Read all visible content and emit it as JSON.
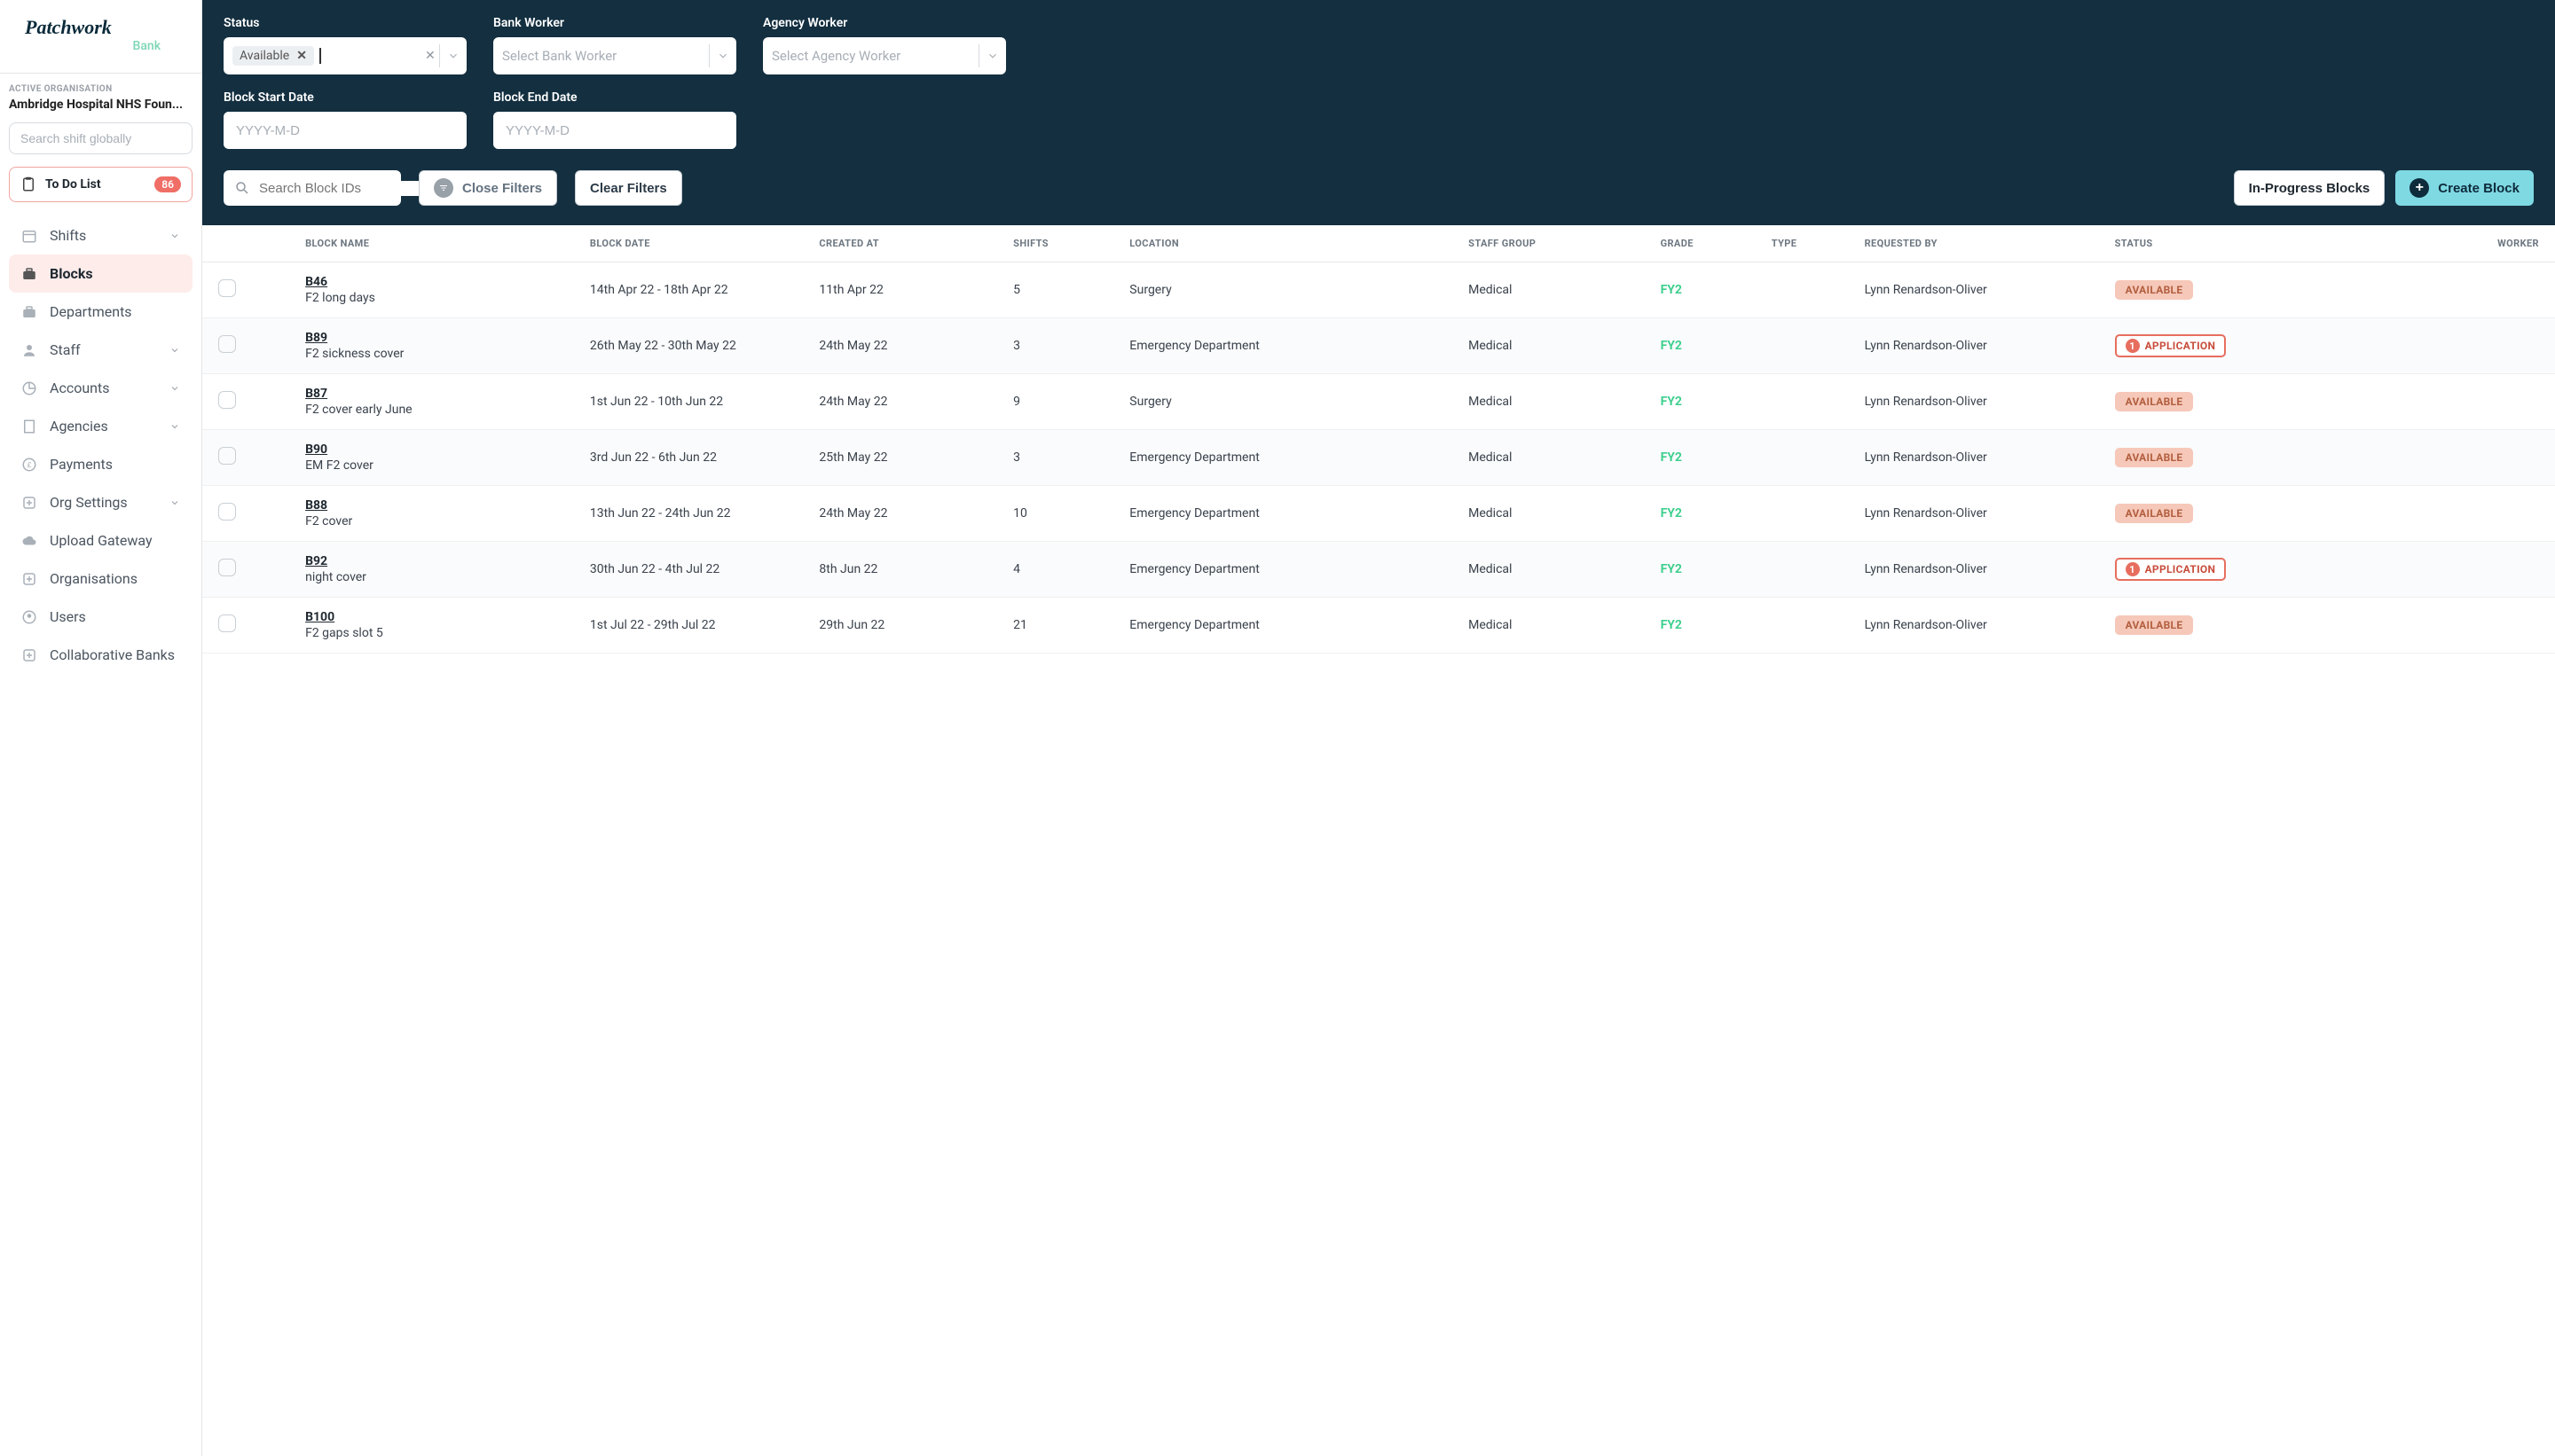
{
  "logo": {
    "main": "Patchwork",
    "sub": "Bank"
  },
  "orgLabel": "ACTIVE ORGANISATION",
  "orgName": "Ambridge Hospital NHS Foun...",
  "globalSearchPlaceholder": "Search shift globally",
  "todo": {
    "label": "To Do List",
    "count": "86"
  },
  "nav": [
    {
      "label": "Shifts",
      "icon": "calendar",
      "expandable": true
    },
    {
      "label": "Blocks",
      "icon": "briefcase",
      "active": true
    },
    {
      "label": "Departments",
      "icon": "briefcase"
    },
    {
      "label": "Staff",
      "icon": "user",
      "expandable": true
    },
    {
      "label": "Accounts",
      "icon": "chart",
      "expandable": true
    },
    {
      "label": "Agencies",
      "icon": "building",
      "expandable": true
    },
    {
      "label": "Payments",
      "icon": "currency"
    },
    {
      "label": "Org Settings",
      "icon": "plus-square",
      "expandable": true
    },
    {
      "label": "Upload Gateway",
      "icon": "cloud"
    },
    {
      "label": "Organisations",
      "icon": "plus-square"
    },
    {
      "label": "Users",
      "icon": "user-circle"
    },
    {
      "label": "Collaborative Banks",
      "icon": "plus-square"
    }
  ],
  "filters": {
    "statusLabel": "Status",
    "statusChip": "Available",
    "bankWorkerLabel": "Bank Worker",
    "bankWorkerPlaceholder": "Select Bank Worker",
    "agencyWorkerLabel": "Agency Worker",
    "agencyWorkerPlaceholder": "Select Agency Worker",
    "startLabel": "Block Start Date",
    "endLabel": "Block End Date",
    "datePlaceholder": "YYYY-M-D"
  },
  "toolbar": {
    "searchPlaceholder": "Search Block IDs",
    "closeFilters": "Close Filters",
    "clearFilters": "Clear Filters",
    "inProgress": "In-Progress Blocks",
    "create": "Create Block"
  },
  "table": {
    "headers": [
      "",
      "BLOCK NAME",
      "BLOCK DATE",
      "CREATED AT",
      "SHIFTS",
      "LOCATION",
      "STAFF GROUP",
      "GRADE",
      "TYPE",
      "REQUESTED BY",
      "STATUS",
      "WORKER"
    ],
    "rows": [
      {
        "id": "B46",
        "desc": "F2 long days",
        "date": "14th Apr 22 - 18th Apr 22",
        "created": "11th Apr 22",
        "shifts": "5",
        "location": "Surgery",
        "staff": "Medical",
        "grade": "FY2",
        "type": "",
        "requested": "Lynn Renardson-Oliver",
        "status": "AVAILABLE",
        "statusType": "available"
      },
      {
        "id": "B89",
        "desc": "F2 sickness cover",
        "date": "26th May 22 - 30th May 22",
        "created": "24th May 22",
        "shifts": "3",
        "location": "Emergency Department",
        "staff": "Medical",
        "grade": "FY2",
        "type": "",
        "requested": "Lynn Renardson-Oliver",
        "status": "APPLICATION",
        "statusType": "application",
        "count": "1"
      },
      {
        "id": "B87",
        "desc": "F2 cover early June",
        "date": "1st Jun 22 - 10th Jun 22",
        "created": "24th May 22",
        "shifts": "9",
        "location": "Surgery",
        "staff": "Medical",
        "grade": "FY2",
        "type": "",
        "requested": "Lynn Renardson-Oliver",
        "status": "AVAILABLE",
        "statusType": "available"
      },
      {
        "id": "B90",
        "desc": "EM F2 cover",
        "date": "3rd Jun 22 - 6th Jun 22",
        "created": "25th May 22",
        "shifts": "3",
        "location": "Emergency Department",
        "staff": "Medical",
        "grade": "FY2",
        "type": "",
        "requested": "Lynn Renardson-Oliver",
        "status": "AVAILABLE",
        "statusType": "available"
      },
      {
        "id": "B88",
        "desc": "F2 cover",
        "date": "13th Jun 22 - 24th Jun 22",
        "created": "24th May 22",
        "shifts": "10",
        "location": "Emergency Department",
        "staff": "Medical",
        "grade": "FY2",
        "type": "",
        "requested": "Lynn Renardson-Oliver",
        "status": "AVAILABLE",
        "statusType": "available"
      },
      {
        "id": "B92",
        "desc": "night cover",
        "date": "30th Jun 22 - 4th Jul 22",
        "created": "8th Jun 22",
        "shifts": "4",
        "location": "Emergency Department",
        "staff": "Medical",
        "grade": "FY2",
        "type": "",
        "requested": "Lynn Renardson-Oliver",
        "status": "APPLICATION",
        "statusType": "application",
        "count": "1"
      },
      {
        "id": "B100",
        "desc": "F2 gaps slot 5",
        "date": "1st Jul 22 - 29th Jul 22",
        "created": "29th Jun 22",
        "shifts": "21",
        "location": "Emergency Department",
        "staff": "Medical",
        "grade": "FY2",
        "type": "",
        "requested": "Lynn Renardson-Oliver",
        "status": "AVAILABLE",
        "statusType": "available"
      }
    ]
  }
}
